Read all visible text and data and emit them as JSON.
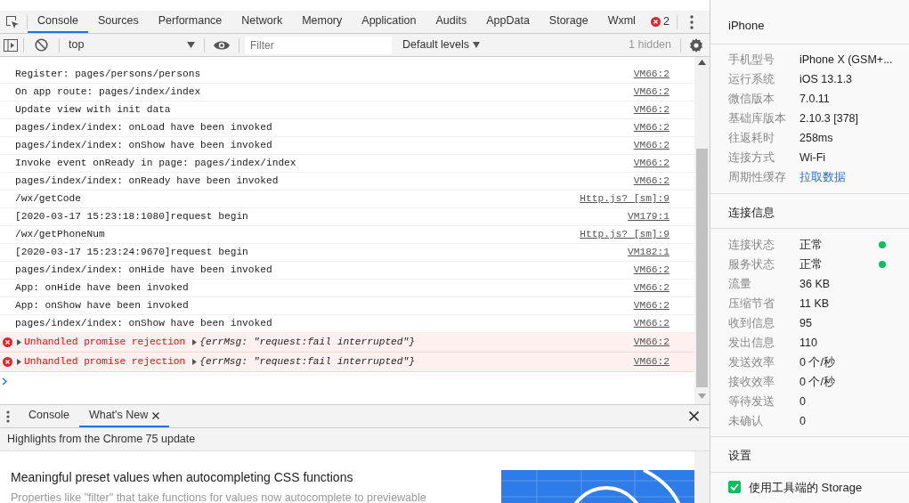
{
  "devtools": {
    "tabs": [
      {
        "label": "Console",
        "selected": true
      },
      {
        "label": "Sources",
        "selected": false
      },
      {
        "label": "Performance",
        "selected": false
      },
      {
        "label": "Network",
        "selected": false
      },
      {
        "label": "Memory",
        "selected": false
      },
      {
        "label": "Application",
        "selected": false
      },
      {
        "label": "Audits",
        "selected": false
      },
      {
        "label": "AppData",
        "selected": false
      },
      {
        "label": "Storage",
        "selected": false
      },
      {
        "label": "Wxml",
        "selected": false
      }
    ],
    "error_count": "2",
    "toolbar": {
      "context": "top",
      "filter_placeholder": "Filter",
      "levels": "Default levels",
      "hidden_count": "1 hidden"
    },
    "log": [
      {
        "kind": "info",
        "message": "Register: pages/persons/persons",
        "source": "VM66:2"
      },
      {
        "kind": "info",
        "message": "On app route: pages/index/index",
        "source": "VM66:2"
      },
      {
        "kind": "info",
        "message": "Update view with init data",
        "source": "VM66:2"
      },
      {
        "kind": "info",
        "message": "pages/index/index: onLoad have been invoked",
        "source": "VM66:2"
      },
      {
        "kind": "info",
        "message": "pages/index/index: onShow have been invoked",
        "source": "VM66:2"
      },
      {
        "kind": "info",
        "message": "Invoke event onReady in page: pages/index/index",
        "source": "VM66:2"
      },
      {
        "kind": "info",
        "message": "pages/index/index: onReady have been invoked",
        "source": "VM66:2"
      },
      {
        "kind": "info",
        "message": "/wx/getCode",
        "source": "Http.js? [sm]:9"
      },
      {
        "kind": "info",
        "message": "[2020-03-17 15:23:18:1080]request begin",
        "source": "VM179:1"
      },
      {
        "kind": "info",
        "message": "/wx/getPhoneNum",
        "source": "Http.js? [sm]:9"
      },
      {
        "kind": "info",
        "message": "[2020-03-17 15:23:24:9670]request begin",
        "source": "VM182:1"
      },
      {
        "kind": "info",
        "message": "pages/index/index: onHide have been invoked",
        "source": "VM66:2"
      },
      {
        "kind": "info",
        "message": "App: onHide have been invoked",
        "source": "VM66:2"
      },
      {
        "kind": "info",
        "message": "App: onShow have been invoked",
        "source": "VM66:2"
      },
      {
        "kind": "info",
        "message": "pages/index/index: onShow have been invoked",
        "source": "VM66:2"
      },
      {
        "kind": "error",
        "message": "Unhandled promise rejection",
        "detail": "{errMsg: \"request:fail interrupted\"}",
        "source": "VM66:2"
      },
      {
        "kind": "error",
        "message": "Unhandled promise rejection",
        "detail": "{errMsg: \"request:fail interrupted\"}",
        "source": "VM66:2"
      }
    ],
    "drawer": {
      "tabs": [
        {
          "label": "Console",
          "selected": false,
          "closable": false
        },
        {
          "label": "What's New",
          "selected": true,
          "closable": true
        }
      ],
      "header": "Highlights from the Chrome 75 update",
      "article_title": "Meaningful preset values when autocompleting CSS functions",
      "article_body": "Properties like \"filter\" that take functions for values now autocomplete to previewable"
    }
  },
  "sidebar": {
    "device_title": "iPhone",
    "device_info": [
      {
        "label": "手机型号",
        "value": "iPhone X (GSM+...",
        "kind": "text"
      },
      {
        "label": "运行系统",
        "value": "iOS 13.1.3",
        "kind": "text"
      },
      {
        "label": "微信版本",
        "value": "7.0.11",
        "kind": "text"
      },
      {
        "label": "基础库版本",
        "value": "2.10.3 [378]",
        "kind": "text"
      },
      {
        "label": "往返耗时",
        "value": "258ms",
        "kind": "text"
      },
      {
        "label": "连接方式",
        "value": "Wi-Fi",
        "kind": "text"
      },
      {
        "label": "周期性缓存",
        "value": "拉取数据",
        "kind": "link"
      }
    ],
    "connection_title": "连接信息",
    "connection_info": [
      {
        "label": "连接状态",
        "value": "正常",
        "color": "#07c160"
      },
      {
        "label": "服务状态",
        "value": "正常",
        "color": "#07c160"
      },
      {
        "label": "流量",
        "value": "36 KB"
      },
      {
        "label": "压缩节省",
        "value": "11 KB"
      },
      {
        "label": "收到信息",
        "value": "95"
      },
      {
        "label": "发出信息",
        "value": "110"
      },
      {
        "label": "发送效率",
        "value": "0 个/秒"
      },
      {
        "label": "接收效率",
        "value": "0 个/秒"
      },
      {
        "label": "等待发送",
        "value": "0"
      },
      {
        "label": "未确认",
        "value": "0"
      }
    ],
    "settings_title": "设置",
    "settings": [
      {
        "label": "使用工具端的 Storage",
        "checked": true
      }
    ]
  }
}
